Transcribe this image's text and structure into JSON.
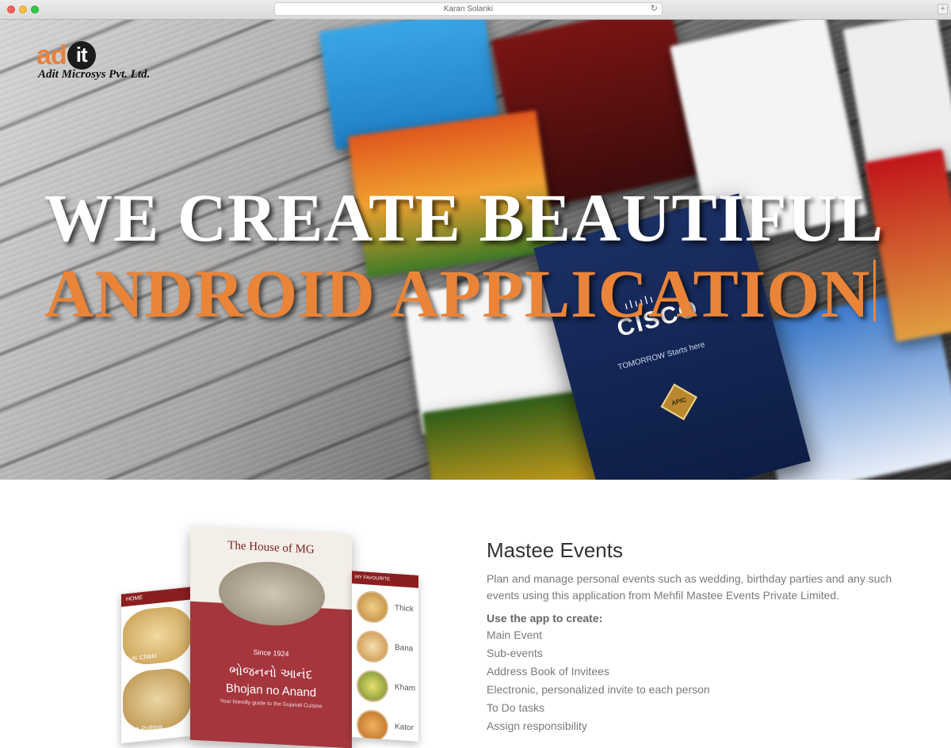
{
  "browser": {
    "url_title": "Karan Solanki",
    "new_tab": "+"
  },
  "logo": {
    "mark_ad": "ad",
    "mark_it": "it",
    "company": "Adit Microsys Pvt. Ltd."
  },
  "hero": {
    "line1": "WE CREATE BEAUTIFUL",
    "line2": "ANDROID APPLICATION",
    "cisco_bars": "ılıılı",
    "cisco_name": "CISCO",
    "cisco_tagline": "TOMORROW Starts here",
    "cisco_badge": "APIC"
  },
  "phones": {
    "left_header": "HOME",
    "left_items": [
      "Nuts Chikki",
      "Thick Puthiya"
    ],
    "main_title": "The House of MG",
    "main_since": "Since 1924",
    "main_gujarati": "ભોજનનો આનંદ",
    "main_bhojan": "Bhojan no Anand",
    "main_guide": "Your friendly guide to the Gujarati Cuisine",
    "right_header": "MY FAVOURITE",
    "right_items": [
      "Thick",
      "Bana",
      "Kham",
      "Kator"
    ]
  },
  "project": {
    "title": "Mastee Events",
    "description": "Plan and manage personal events such as wedding, birthday parties and any such events using this application from Mehfil Mastee Events Private Limited.",
    "list_heading": "Use the app to create:",
    "features": [
      "Main Event",
      "Sub-events",
      "Address Book of Invitees",
      "Electronic, personalized invite to each person",
      "To Do tasks",
      "Assign responsibility"
    ]
  },
  "colors": {
    "accent_orange": "#ea8438",
    "cisco_blue": "#1b2f63",
    "maroon": "#a5363d"
  }
}
